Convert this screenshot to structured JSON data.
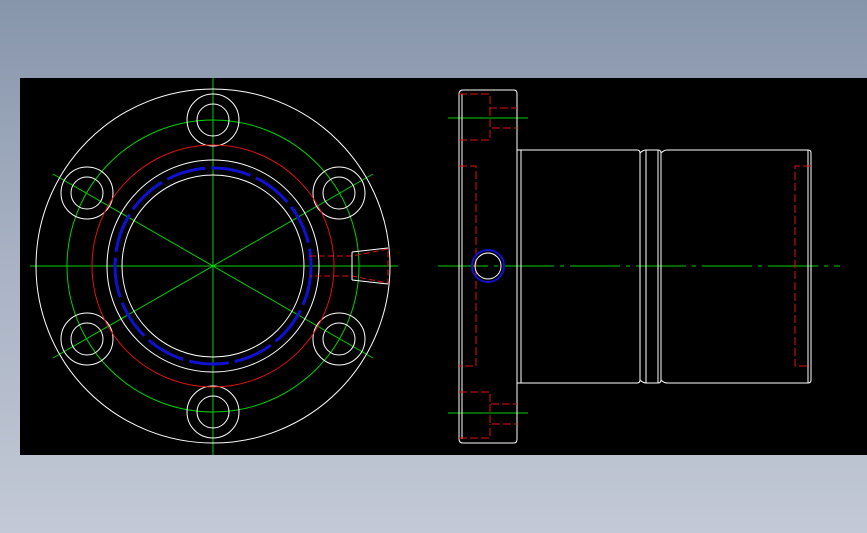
{
  "drawing": {
    "background": "#000000",
    "colors": {
      "outline": "#ffffff",
      "centerline": "#00d000",
      "hidden": "#e01010",
      "thread": "#1010d0"
    },
    "front_view": {
      "bolt_hole_count": 6,
      "bolt_hole_angles_deg": [
        90,
        30,
        -30,
        -90,
        -150,
        150
      ]
    },
    "side_view": {
      "features": [
        "flange",
        "body",
        "groove",
        "oil-hole"
      ]
    }
  }
}
